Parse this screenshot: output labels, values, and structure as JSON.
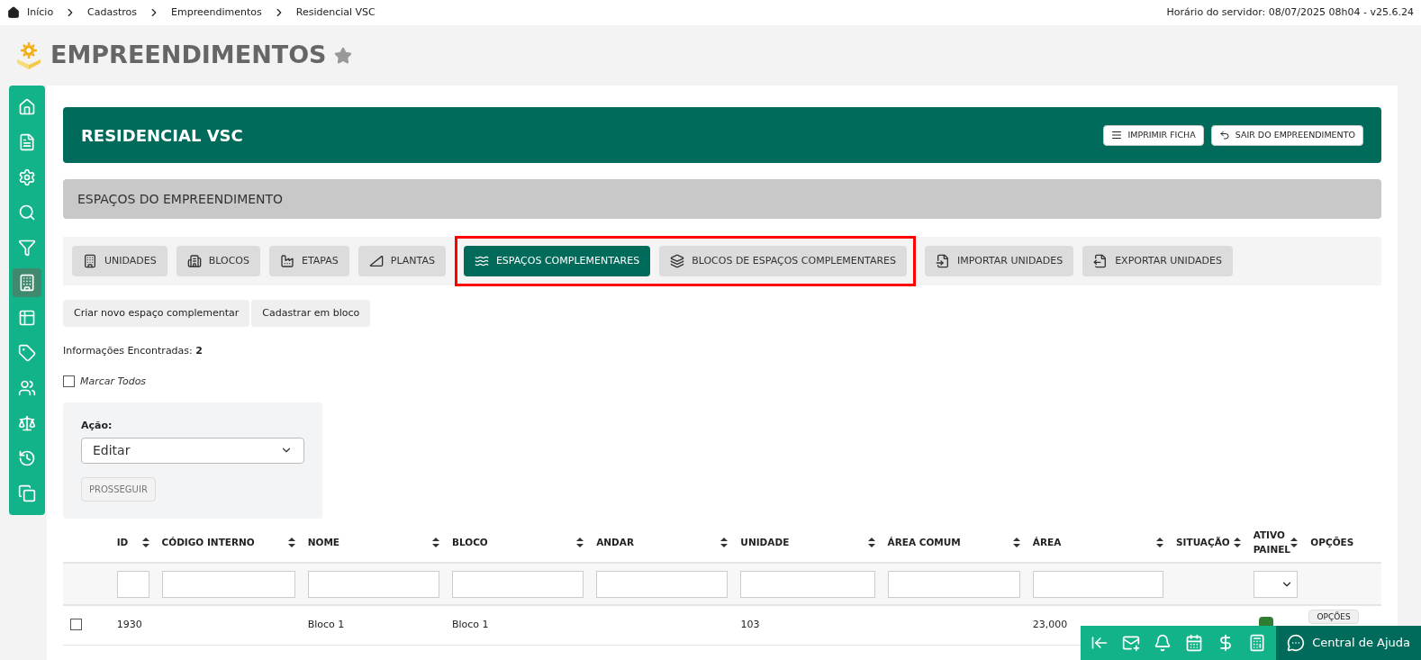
{
  "breadcrumb": [
    "Início",
    "Cadastros",
    "Empreendimentos",
    "Residencial VSC"
  ],
  "server_info": "Horário do servidor: 08/07/2025 08h04 - v25.6.24",
  "page_title": "EMPREENDIMENTOS",
  "favorite": false,
  "sidebar": {
    "items": [
      {
        "selected": false
      },
      {
        "selected": false
      },
      {
        "selected": false
      },
      {
        "selected": false
      },
      {
        "selected": false
      },
      {
        "selected": true
      },
      {
        "selected": false
      },
      {
        "selected": false
      },
      {
        "selected": false
      },
      {
        "selected": false
      },
      {
        "selected": false
      },
      {
        "selected": false
      }
    ]
  },
  "project": {
    "title": "RESIDENCIAL VSC",
    "buttons": [
      "IMPRIMIR FICHA",
      "SAIR DO EMPREENDIMENTO"
    ]
  },
  "section_title": "ESPAÇOS DO EMPREENDIMENTO",
  "tabs": [
    {
      "label": "UNIDADES",
      "selected": false,
      "highlighted": false
    },
    {
      "label": "BLOCOS",
      "selected": false,
      "highlighted": false
    },
    {
      "label": "ETAPAS",
      "selected": false,
      "highlighted": false
    },
    {
      "label": "PLANTAS",
      "selected": false,
      "highlighted": false
    },
    {
      "label": "ESPAÇOS COMPLEMENTARES",
      "selected": true,
      "highlighted": true
    },
    {
      "label": "BLOCOS DE ESPAÇOS COMPLEMENTARES",
      "selected": false,
      "highlighted": true
    },
    {
      "label": "IMPORTAR UNIDADES",
      "selected": false,
      "highlighted": false
    },
    {
      "label": "EXPORTAR UNIDADES",
      "selected": false,
      "highlighted": false
    }
  ],
  "actions": [
    "Criar novo espaço complementar",
    "Cadastrar em bloco"
  ],
  "found": {
    "label": "Informações Encontradas:",
    "count": "2"
  },
  "select_all": {
    "label": "Marcar Todos",
    "checked": false
  },
  "bulk": {
    "label": "Ação:",
    "value": "Editar",
    "button": "PROSSEGUIR"
  },
  "table": {
    "columns": [
      {
        "label": "ID",
        "kind": "text"
      },
      {
        "label": "CÓDIGO INTERNO",
        "kind": "text"
      },
      {
        "label": "NOME",
        "kind": "text"
      },
      {
        "label": "BLOCO",
        "kind": "text"
      },
      {
        "label": "ANDAR",
        "kind": "text"
      },
      {
        "label": "UNIDADE",
        "kind": "text"
      },
      {
        "label": "ÁREA COMUM",
        "kind": "text"
      },
      {
        "label": "ÁREA",
        "kind": "text"
      },
      {
        "label": "SITUAÇÃO",
        "kind": "plain"
      },
      {
        "label": "ATIVO PAINEL",
        "kind": "select"
      },
      {
        "label": "OPÇÕES",
        "kind": "fixed"
      }
    ],
    "rows": [
      {
        "checked": false,
        "cells": [
          "1930",
          "",
          "Bloco 1",
          "Bloco 1",
          "",
          "103",
          "",
          "23,000"
        ],
        "options": "OPÇÕES"
      }
    ]
  },
  "help": "Central de Ajuda"
}
